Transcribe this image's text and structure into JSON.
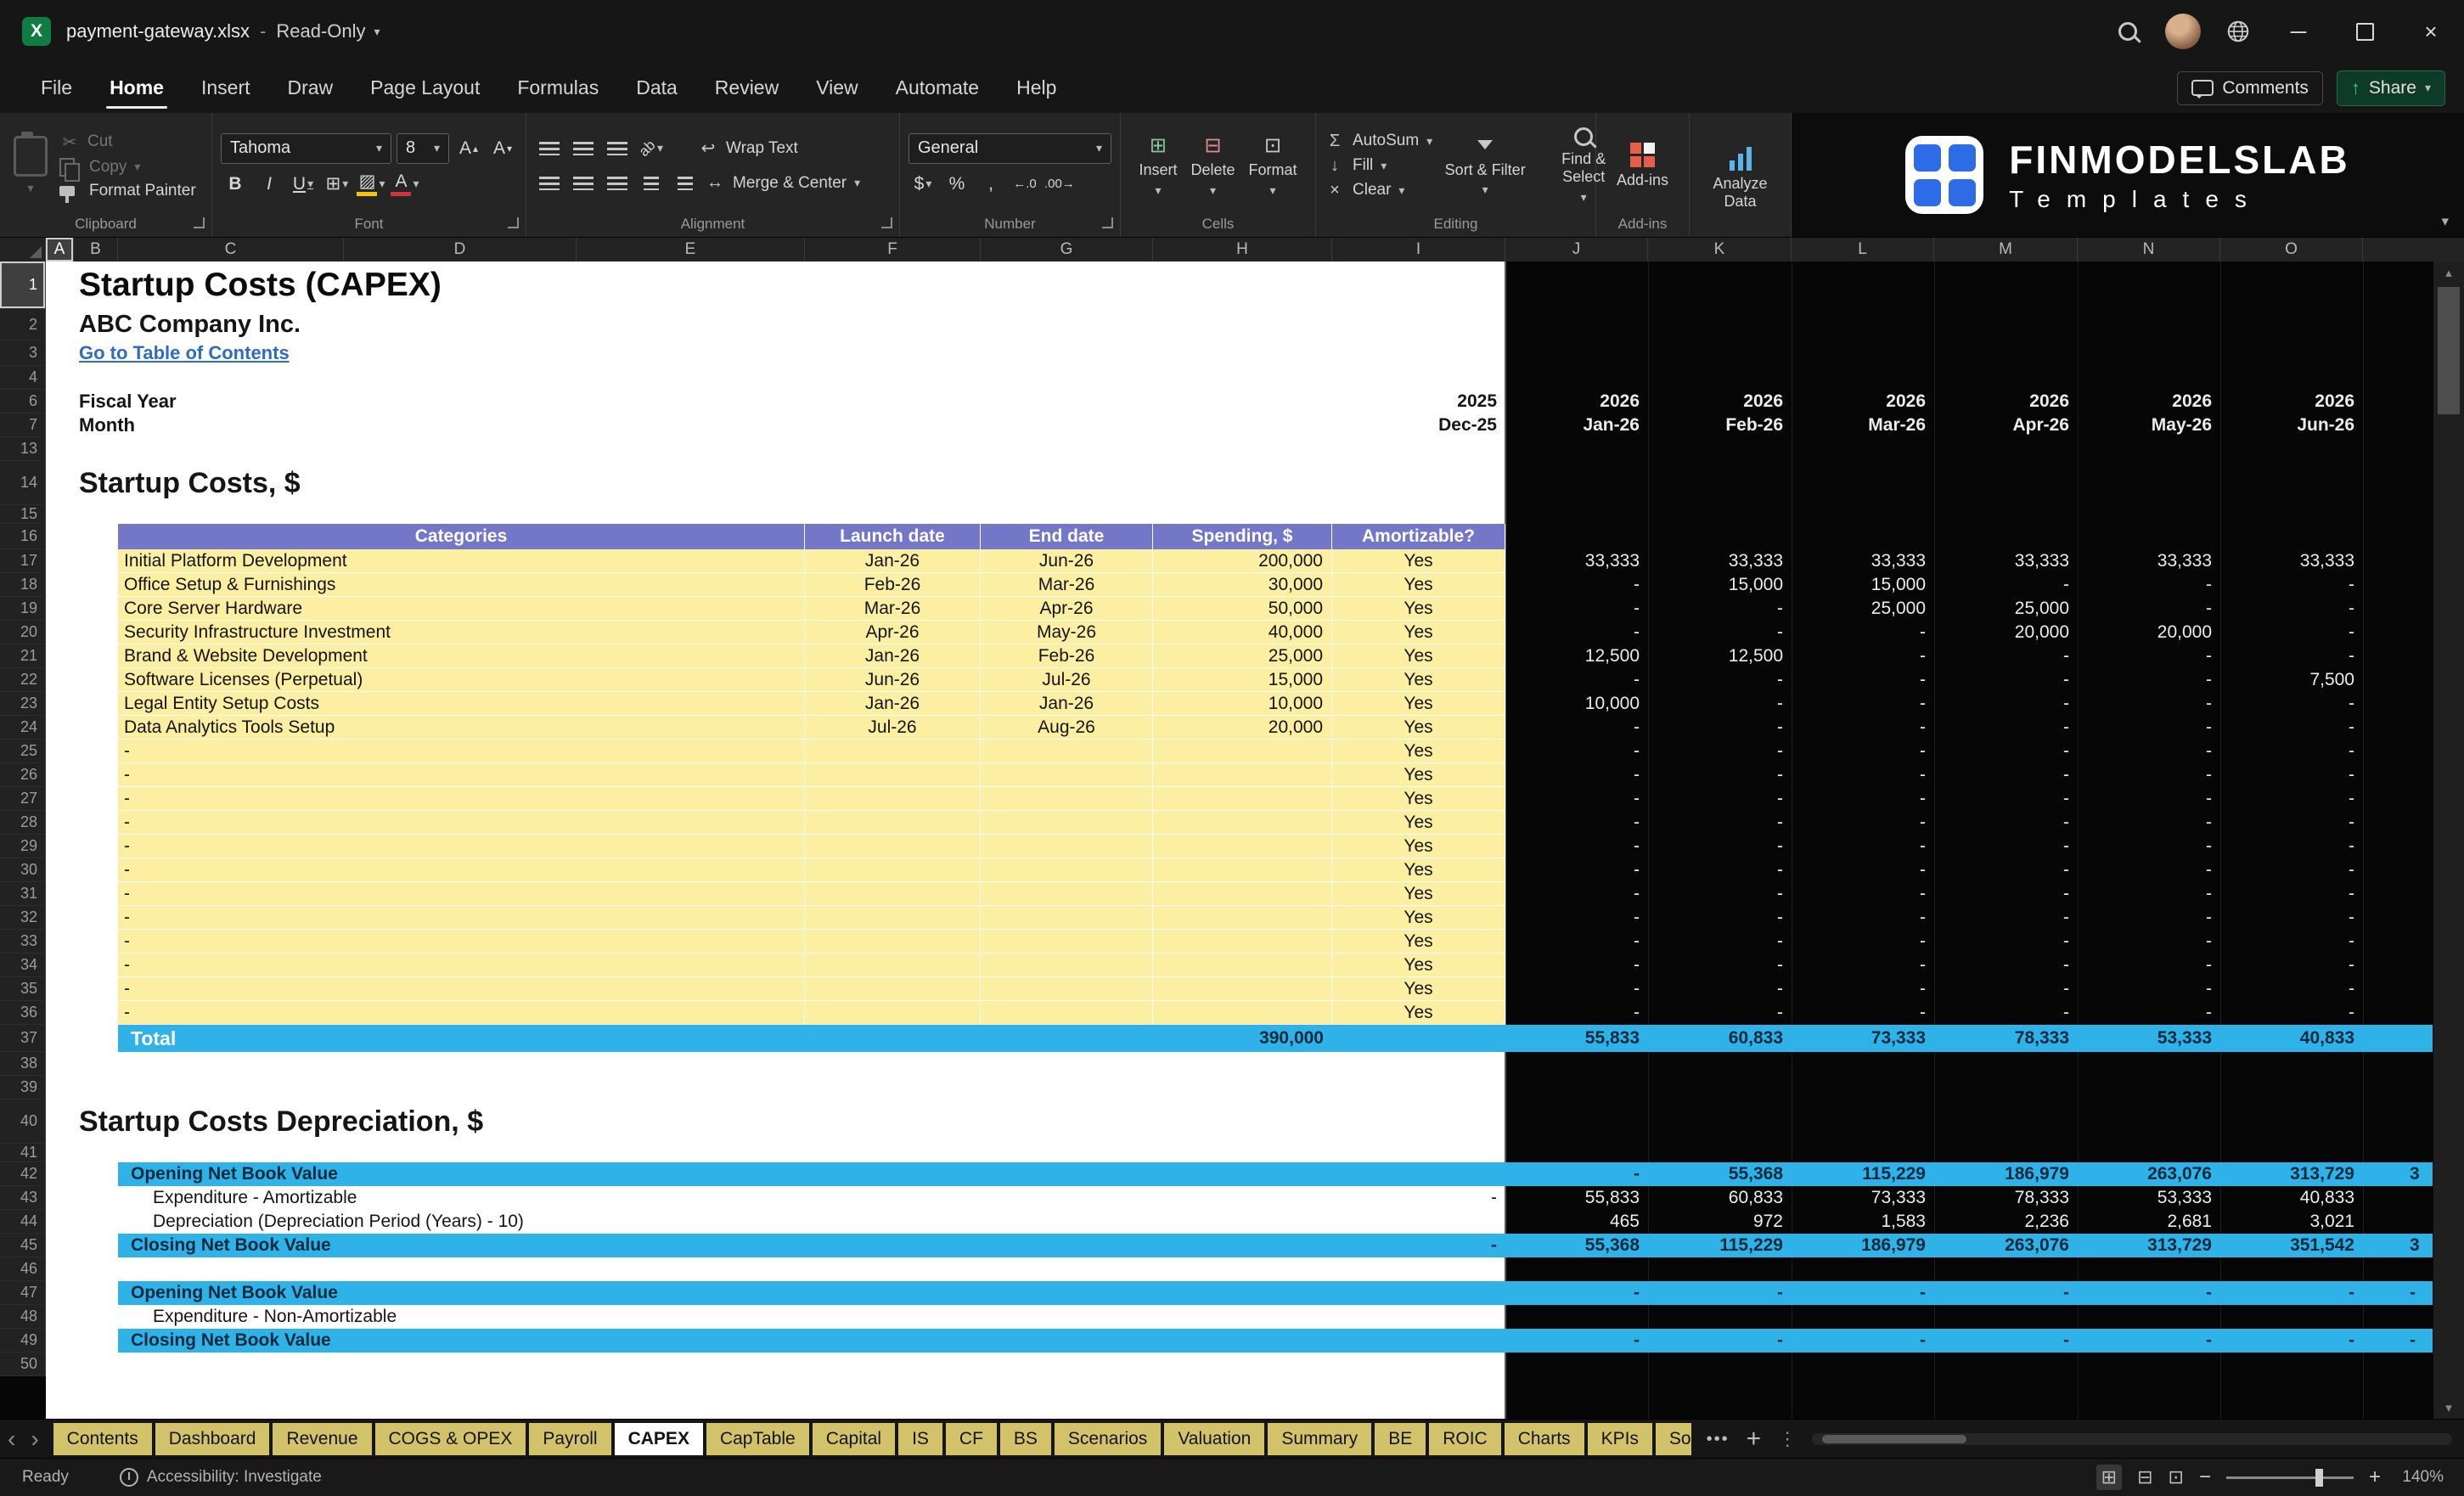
{
  "title_bar": {
    "file_name": "payment-gateway.xlsx",
    "separator": "-",
    "mode": "Read-Only"
  },
  "menu": {
    "items": [
      "File",
      "Home",
      "Insert",
      "Draw",
      "Page Layout",
      "Formulas",
      "Data",
      "Review",
      "View",
      "Automate",
      "Help"
    ],
    "active_item": "Home",
    "comments_label": "Comments",
    "share_label": "Share"
  },
  "ribbon": {
    "clipboard": {
      "cut_label": "Cut",
      "copy_label": "Copy",
      "format_painter_label": "Format Painter",
      "group_label": "Clipboard"
    },
    "font": {
      "font_name": "Tahoma",
      "font_size": "8",
      "bold": "B",
      "italic": "I",
      "underline": "U",
      "group_label": "Font"
    },
    "alignment": {
      "wrap_text_label": "Wrap Text",
      "merge_center_label": "Merge & Center",
      "group_label": "Alignment"
    },
    "number": {
      "number_format": "General",
      "currency": "$",
      "percent": "%",
      "comma": ",",
      "group_label": "Number"
    },
    "cells": {
      "insert_label": "Insert",
      "delete_label": "Delete",
      "format_label": "Format",
      "group_label": "Cells"
    },
    "editing": {
      "autosum_label": "AutoSum",
      "fill_label": "Fill",
      "clear_label": "Clear",
      "sort_filter_label": "Sort & Filter",
      "find_select_label": "Find & Select",
      "group_label": "Editing"
    },
    "addins": {
      "button_label": "Add-ins",
      "group_label": "Add-ins"
    },
    "analyze_label": "Analyze Data"
  },
  "logo": {
    "brand": "FINMODELSLAB",
    "tagline": "Templates"
  },
  "sheet": {
    "columns": [
      "A",
      "B",
      "C",
      "D",
      "E",
      "F",
      "G",
      "H",
      "I",
      "J",
      "K",
      "L",
      "M",
      "N",
      "O"
    ],
    "selected_column": "A",
    "selected_row": "1",
    "rows": [
      {
        "n": "1",
        "type": "title",
        "text": "Startup Costs (CAPEX)"
      },
      {
        "n": "2",
        "type": "subtitle",
        "text": "ABC Company Inc."
      },
      {
        "n": "3",
        "type": "link",
        "text": "Go to Table of Contents"
      },
      {
        "n": "4",
        "type": "blank"
      },
      {
        "n": "6",
        "type": "frow",
        "label": "Fiscal Year",
        "i": "2025",
        "vals": [
          "2026",
          "2026",
          "2026",
          "2026",
          "2026",
          "2026"
        ]
      },
      {
        "n": "7",
        "type": "frow",
        "label": "Month",
        "i": "Dec-25",
        "vals": [
          "Jan-26",
          "Feb-26",
          "Mar-26",
          "Apr-26",
          "May-26",
          "Jun-26"
        ]
      },
      {
        "n": "13",
        "type": "blank"
      },
      {
        "n": "14",
        "type": "section",
        "text": "Startup Costs, $"
      },
      {
        "n": "15",
        "type": "blank_s"
      },
      {
        "n": "16",
        "type": "thead",
        "headers": [
          "Categories",
          "Launch date",
          "End date",
          "Spending, $",
          "Amortizable?"
        ]
      },
      {
        "n": "17",
        "type": "trow",
        "category": "Initial Platform Development",
        "launch": "Jan-26",
        "end": "Jun-26",
        "spending": "200,000",
        "amortizable": "Yes",
        "vals": [
          "33,333",
          "33,333",
          "33,333",
          "33,333",
          "33,333",
          "33,333"
        ]
      },
      {
        "n": "18",
        "type": "trow",
        "category": "Office Setup & Furnishings",
        "launch": "Feb-26",
        "end": "Mar-26",
        "spending": "30,000",
        "amortizable": "Yes",
        "vals": [
          "-",
          "15,000",
          "15,000",
          "-",
          "-",
          "-"
        ]
      },
      {
        "n": "19",
        "type": "trow",
        "category": "Core Server Hardware",
        "launch": "Mar-26",
        "end": "Apr-26",
        "spending": "50,000",
        "amortizable": "Yes",
        "vals": [
          "-",
          "-",
          "25,000",
          "25,000",
          "-",
          "-"
        ]
      },
      {
        "n": "20",
        "type": "trow",
        "category": "Security Infrastructure Investment",
        "launch": "Apr-26",
        "end": "May-26",
        "spending": "40,000",
        "amortizable": "Yes",
        "vals": [
          "-",
          "-",
          "-",
          "20,000",
          "20,000",
          "-"
        ]
      },
      {
        "n": "21",
        "type": "trow",
        "category": "Brand & Website Development",
        "launch": "Jan-26",
        "end": "Feb-26",
        "spending": "25,000",
        "amortizable": "Yes",
        "vals": [
          "12,500",
          "12,500",
          "-",
          "-",
          "-",
          "-"
        ]
      },
      {
        "n": "22",
        "type": "trow",
        "category": "Software Licenses (Perpetual)",
        "launch": "Jun-26",
        "end": "Jul-26",
        "spending": "15,000",
        "amortizable": "Yes",
        "vals": [
          "-",
          "-",
          "-",
          "-",
          "-",
          "7,500"
        ]
      },
      {
        "n": "23",
        "type": "trow",
        "category": "Legal Entity Setup Costs",
        "launch": "Jan-26",
        "end": "Jan-26",
        "spending": "10,000",
        "amortizable": "Yes",
        "vals": [
          "10,000",
          "-",
          "-",
          "-",
          "-",
          "-"
        ]
      },
      {
        "n": "24",
        "type": "trow",
        "category": "Data Analytics Tools Setup",
        "launch": "Jul-26",
        "end": "Aug-26",
        "spending": "20,000",
        "amortizable": "Yes",
        "vals": [
          "-",
          "-",
          "-",
          "-",
          "-",
          "-"
        ]
      },
      {
        "n": "25",
        "type": "trow",
        "category": "-",
        "launch": "",
        "end": "",
        "spending": "",
        "amortizable": "Yes",
        "vals": [
          "-",
          "-",
          "-",
          "-",
          "-",
          "-"
        ]
      },
      {
        "n": "26",
        "type": "trow",
        "category": "-",
        "launch": "",
        "end": "",
        "spending": "",
        "amortizable": "Yes",
        "vals": [
          "-",
          "-",
          "-",
          "-",
          "-",
          "-"
        ]
      },
      {
        "n": "27",
        "type": "trow",
        "category": "-",
        "launch": "",
        "end": "",
        "spending": "",
        "amortizable": "Yes",
        "vals": [
          "-",
          "-",
          "-",
          "-",
          "-",
          "-"
        ]
      },
      {
        "n": "28",
        "type": "trow",
        "category": "-",
        "launch": "",
        "end": "",
        "spending": "",
        "amortizable": "Yes",
        "vals": [
          "-",
          "-",
          "-",
          "-",
          "-",
          "-"
        ]
      },
      {
        "n": "29",
        "type": "trow",
        "category": "-",
        "launch": "",
        "end": "",
        "spending": "",
        "amortizable": "Yes",
        "vals": [
          "-",
          "-",
          "-",
          "-",
          "-",
          "-"
        ]
      },
      {
        "n": "30",
        "type": "trow",
        "category": "-",
        "launch": "",
        "end": "",
        "spending": "",
        "amortizable": "Yes",
        "vals": [
          "-",
          "-",
          "-",
          "-",
          "-",
          "-"
        ]
      },
      {
        "n": "31",
        "type": "trow",
        "category": "-",
        "launch": "",
        "end": "",
        "spending": "",
        "amortizable": "Yes",
        "vals": [
          "-",
          "-",
          "-",
          "-",
          "-",
          "-"
        ]
      },
      {
        "n": "32",
        "type": "trow",
        "category": "-",
        "launch": "",
        "end": "",
        "spending": "",
        "amortizable": "Yes",
        "vals": [
          "-",
          "-",
          "-",
          "-",
          "-",
          "-"
        ]
      },
      {
        "n": "33",
        "type": "trow",
        "category": "-",
        "launch": "",
        "end": "",
        "spending": "",
        "amortizable": "Yes",
        "vals": [
          "-",
          "-",
          "-",
          "-",
          "-",
          "-"
        ]
      },
      {
        "n": "34",
        "type": "trow",
        "category": "-",
        "launch": "",
        "end": "",
        "spending": "",
        "amortizable": "Yes",
        "vals": [
          "-",
          "-",
          "-",
          "-",
          "-",
          "-"
        ]
      },
      {
        "n": "35",
        "type": "trow",
        "category": "-",
        "launch": "",
        "end": "",
        "spending": "",
        "amortizable": "Yes",
        "vals": [
          "-",
          "-",
          "-",
          "-",
          "-",
          "-"
        ]
      },
      {
        "n": "36",
        "type": "trow",
        "category": "-",
        "launch": "",
        "end": "",
        "spending": "",
        "amortizable": "Yes",
        "vals": [
          "-",
          "-",
          "-",
          "-",
          "-",
          "-"
        ]
      },
      {
        "n": "37",
        "type": "total",
        "label": "Total",
        "spending": "390,000",
        "vals": [
          "55,833",
          "60,833",
          "73,333",
          "78,333",
          "53,333",
          "40,833"
        ]
      },
      {
        "n": "38",
        "type": "blank"
      },
      {
        "n": "39",
        "type": "blank"
      },
      {
        "n": "40",
        "type": "section",
        "text": "Startup Costs Depreciation, $"
      },
      {
        "n": "41",
        "type": "blank_s"
      },
      {
        "n": "42",
        "type": "band",
        "label": "Opening Net Book Value",
        "i": "",
        "vals": [
          "-",
          "55,368",
          "115,229",
          "186,979",
          "263,076",
          "313,729"
        ],
        "partial": "3"
      },
      {
        "n": "43",
        "type": "drow",
        "label": "Expenditure - Amortizable",
        "i": "-",
        "vals": [
          "55,833",
          "60,833",
          "73,333",
          "78,333",
          "53,333",
          "40,833"
        ]
      },
      {
        "n": "44",
        "type": "drow",
        "label": "Depreciation (Depreciation Period (Years) - 10)",
        "i": "",
        "vals": [
          "465",
          "972",
          "1,583",
          "2,236",
          "2,681",
          "3,021"
        ]
      },
      {
        "n": "45",
        "type": "band",
        "label": "Closing Net Book Value",
        "i": "-",
        "vals": [
          "55,368",
          "115,229",
          "186,979",
          "263,076",
          "313,729",
          "351,542"
        ],
        "partial": "3"
      },
      {
        "n": "46",
        "type": "blank"
      },
      {
        "n": "47",
        "type": "band",
        "label": "Opening Net Book Value",
        "i": "",
        "vals": [
          "-",
          "-",
          "-",
          "-",
          "-",
          "-"
        ],
        "partial": "-"
      },
      {
        "n": "48",
        "type": "drow",
        "label": "Expenditure - Non-Amortizable",
        "i": "",
        "vals": [
          "",
          "",
          "",
          "",
          "",
          ""
        ]
      },
      {
        "n": "49",
        "type": "band",
        "label": "Closing Net Book Value",
        "i": "",
        "vals": [
          "-",
          "-",
          "-",
          "-",
          "-",
          "-"
        ],
        "partial": "-"
      },
      {
        "n": "50",
        "type": "blank"
      }
    ]
  },
  "tab_bar": {
    "tabs": [
      "Contents",
      "Dashboard",
      "Revenue",
      "COGS & OPEX",
      "Payroll",
      "CAPEX",
      "CapTable",
      "Capital",
      "IS",
      "CF",
      "BS",
      "Scenarios",
      "Valuation",
      "Summary",
      "BE",
      "ROIC",
      "Charts",
      "KPIs",
      "So"
    ],
    "active_tab": "CAPEX"
  },
  "status_bar": {
    "ready_label": "Ready",
    "accessibility_label": "Accessibility: Investigate",
    "zoom_level": "140%"
  }
}
